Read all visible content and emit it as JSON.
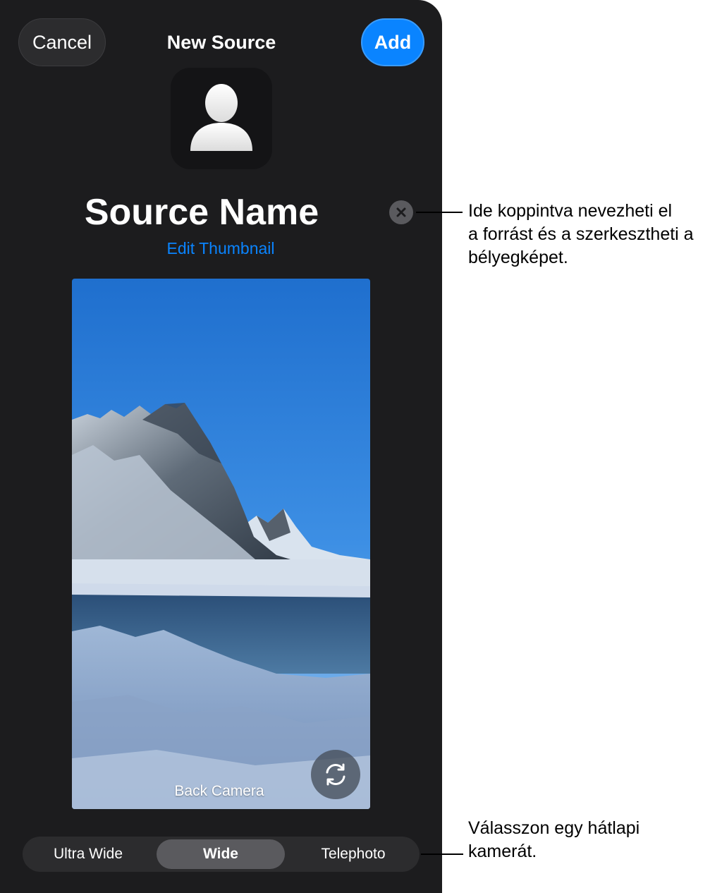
{
  "nav": {
    "cancel_label": "Cancel",
    "title": "New Source",
    "add_label": "Add"
  },
  "source": {
    "name": "Source Name",
    "edit_thumbnail_label": "Edit Thumbnail"
  },
  "preview": {
    "camera_label": "Back Camera",
    "switch_icon": "camera-switch-icon"
  },
  "lens_selector": {
    "options": [
      "Ultra Wide",
      "Wide",
      "Telephoto"
    ],
    "selected": "Wide"
  },
  "callouts": {
    "name_edit": {
      "line1": "Ide koppintva nevezheti el",
      "line2": "a forrást és a szerkesztheti a",
      "line3": "bélyegképet."
    },
    "camera_select": {
      "line1": "Válasszon egy hátlapi",
      "line2": "kamerát."
    }
  },
  "colors": {
    "accent": "#0a84ff",
    "panel_bg": "#1c1c1e",
    "control_bg": "#2c2c2e",
    "selected_segment": "#5a5a5e"
  }
}
